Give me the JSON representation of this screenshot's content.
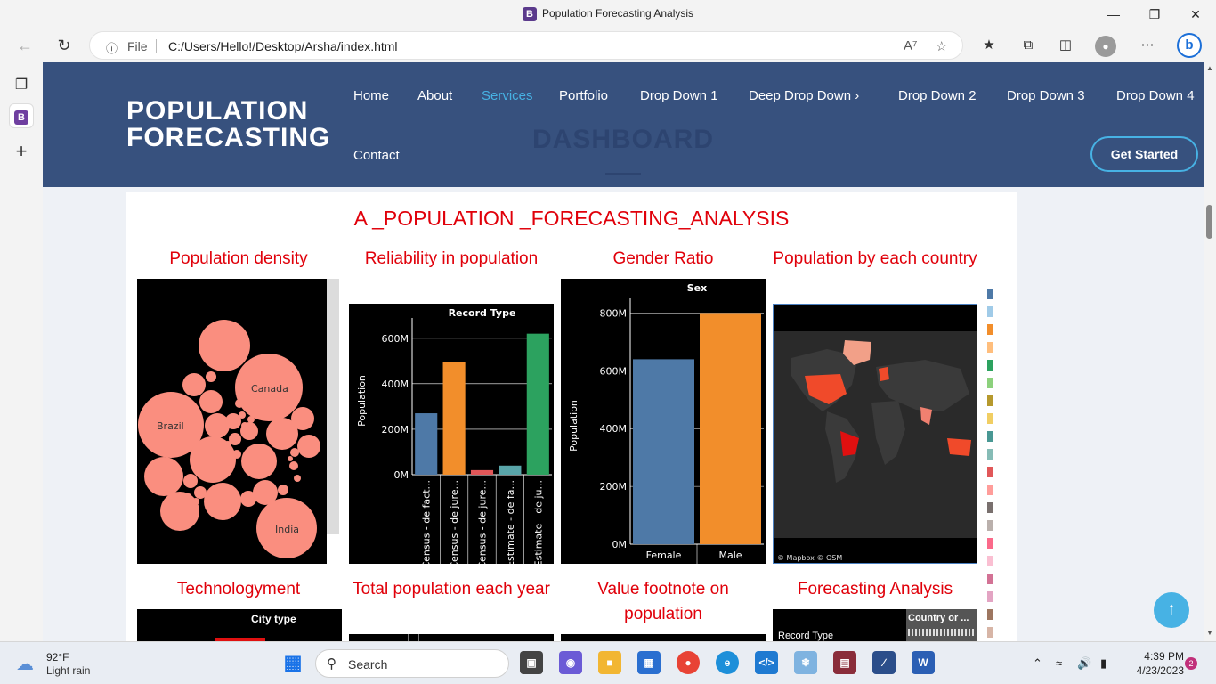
{
  "window": {
    "title": "Population Forecasting Analysis",
    "favicon_letter": "B"
  },
  "browser": {
    "file_label": "File",
    "url": "C:/Users/Hello!/Desktop/Arsha/index.html"
  },
  "site": {
    "logo_line1": "POPULATION",
    "logo_line2": "FORECASTING",
    "nav": [
      {
        "label": "Home"
      },
      {
        "label": "About"
      },
      {
        "label": "Services"
      },
      {
        "label": "Portfolio"
      },
      {
        "label": "Drop Down 1"
      },
      {
        "label": "Deep Drop Down"
      },
      {
        "label": "Drop Down 2"
      },
      {
        "label": "Drop Down 3"
      },
      {
        "label": "Drop Down 4"
      },
      {
        "label": "Contact"
      }
    ],
    "active_nav": "Services",
    "ghost_heading": "DASHBOARD",
    "cta": "Get Started",
    "accent": "#47b2e4",
    "header_bg": "#37517e"
  },
  "dashboard": {
    "title": "A _POPULATION _FORECASTING_ANALYSIS",
    "titles": {
      "density": "Population density",
      "reliability": "Reliability in population",
      "gender": "Gender Ratio",
      "country": "Population by each country",
      "technology": "Technologyment",
      "total": "Total population each year",
      "footnote": "Value footnote on population",
      "forecast": "Forecasting Analysis"
    },
    "density_labels": [
      "Brazil",
      "Canada",
      "India"
    ],
    "map_credit": "© Mapbox  © OSM",
    "tech_header": "City type",
    "forecast_header1": "Country or ...",
    "forecast_header2": "Record Type"
  },
  "chart_data": [
    {
      "type": "bar",
      "title": "Record Type",
      "ylabel": "Population",
      "categories": [
        "Census - de fact...",
        "Census - de jure...",
        "Census - de jure...",
        "Estimate - de fa...",
        "Estimate - de ju..."
      ],
      "values": [
        270000000,
        495000000,
        20000000,
        40000000,
        620000000
      ],
      "colors": [
        "#4e79a7",
        "#f28e2b",
        "#e15759",
        "#59a5a9",
        "#2ca25f"
      ],
      "ylim": [
        0,
        650000000
      ],
      "yticks": [
        "0M",
        "200M",
        "400M",
        "600M"
      ]
    },
    {
      "type": "bar",
      "title": "Sex",
      "ylabel": "Population",
      "categories": [
        "Female",
        "Male"
      ],
      "values": [
        640000000,
        800000000
      ],
      "colors": [
        "#4e79a7",
        "#f28e2b"
      ],
      "ylim": [
        0,
        820000000
      ],
      "yticks": [
        "0M",
        "200M",
        "400M",
        "600M",
        "800M"
      ]
    }
  ],
  "legend_colors": [
    "#4e79a7",
    "#a0cbe8",
    "#f28e2b",
    "#ffbe7d",
    "#2ca25f",
    "#8cd17d",
    "#b6992d",
    "#f1ce63",
    "#499894",
    "#86bcb6",
    "#e15759",
    "#ff9d9a",
    "#79706e",
    "#bab0ac",
    "#fb6a8a",
    "#fabfd2",
    "#d37295",
    "#e3a4c3",
    "#9d7660",
    "#d7b5a6"
  ],
  "taskbar": {
    "temp": "92°F",
    "weather": "Light rain",
    "search": "Search",
    "time": "4:39 PM",
    "date": "4/23/2023",
    "notifications": "2"
  }
}
